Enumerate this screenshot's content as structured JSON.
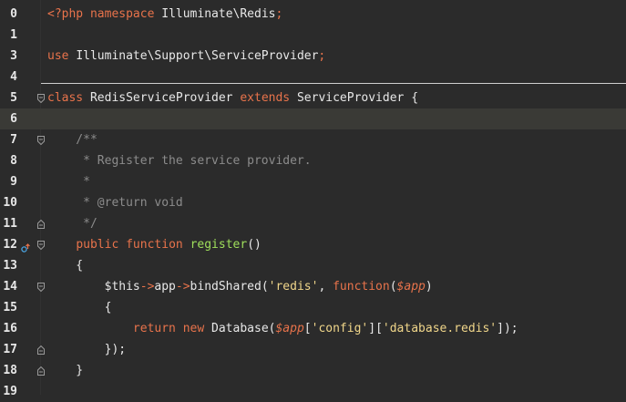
{
  "editor": {
    "language": "php",
    "current_line": 6,
    "colors": {
      "background": "#2b2b2b",
      "current_line": "#3a3a36",
      "keyword": "#e8734b",
      "plain": "#e8e8e8",
      "comment": "#8c8c8c",
      "string": "#f0d68a",
      "function_name": "#9fdf5b"
    },
    "lines": [
      {
        "number": "0",
        "fold": null,
        "tokens": [
          {
            "t": "kw",
            "v": "<?php "
          },
          {
            "t": "kw",
            "v": "namespace "
          },
          {
            "t": "plain",
            "v": "Illuminate\\Redis"
          },
          {
            "t": "kw",
            "v": ";"
          }
        ]
      },
      {
        "number": "1",
        "fold": null,
        "tokens": []
      },
      {
        "number": "3",
        "fold": null,
        "tokens": [
          {
            "t": "kw",
            "v": "use "
          },
          {
            "t": "plain",
            "v": "Illuminate\\Support\\ServiceProvider"
          },
          {
            "t": "kw",
            "v": ";"
          }
        ]
      },
      {
        "number": "4",
        "fold": null,
        "tokens": []
      },
      {
        "number": "5",
        "fold": "open",
        "tokens": [
          {
            "t": "kw",
            "v": "class "
          },
          {
            "t": "plain",
            "v": "RedisServiceProvider "
          },
          {
            "t": "kw",
            "v": "extends "
          },
          {
            "t": "plain",
            "v": "ServiceProvider {"
          }
        ]
      },
      {
        "number": "6",
        "fold": null,
        "tokens": []
      },
      {
        "number": "7",
        "fold": "open",
        "tokens": [
          {
            "t": "cmt",
            "v": "    /**"
          }
        ]
      },
      {
        "number": "8",
        "fold": null,
        "tokens": [
          {
            "t": "cmt",
            "v": "     * Register the service provider."
          }
        ]
      },
      {
        "number": "9",
        "fold": null,
        "tokens": [
          {
            "t": "cmt",
            "v": "     *"
          }
        ]
      },
      {
        "number": "10",
        "fold": null,
        "tokens": [
          {
            "t": "cmt",
            "v": "     * @return void"
          }
        ]
      },
      {
        "number": "11",
        "fold": "close",
        "tokens": [
          {
            "t": "cmt",
            "v": "     */"
          }
        ]
      },
      {
        "number": "12",
        "fold": "open",
        "override": true,
        "tokens": [
          {
            "t": "plain",
            "v": "    "
          },
          {
            "t": "kw",
            "v": "public "
          },
          {
            "t": "kw",
            "v": "function "
          },
          {
            "t": "fn",
            "v": "register"
          },
          {
            "t": "plain",
            "v": "()"
          }
        ]
      },
      {
        "number": "13",
        "fold": null,
        "tokens": [
          {
            "t": "plain",
            "v": "    {"
          }
        ]
      },
      {
        "number": "14",
        "fold": "open",
        "tokens": [
          {
            "t": "plain",
            "v": "        $this"
          },
          {
            "t": "op",
            "v": "->"
          },
          {
            "t": "plain",
            "v": "app"
          },
          {
            "t": "op",
            "v": "->"
          },
          {
            "t": "plain",
            "v": "bindShared("
          },
          {
            "t": "str",
            "v": "'redis'"
          },
          {
            "t": "plain",
            "v": ", "
          },
          {
            "t": "kw",
            "v": "function"
          },
          {
            "t": "plain",
            "v": "("
          },
          {
            "t": "var",
            "v": "$app"
          },
          {
            "t": "plain",
            "v": ")"
          }
        ]
      },
      {
        "number": "15",
        "fold": null,
        "tokens": [
          {
            "t": "plain",
            "v": "        {"
          }
        ]
      },
      {
        "number": "16",
        "fold": null,
        "tokens": [
          {
            "t": "plain",
            "v": "            "
          },
          {
            "t": "kw",
            "v": "return "
          },
          {
            "t": "kw",
            "v": "new "
          },
          {
            "t": "plain",
            "v": "Database("
          },
          {
            "t": "var",
            "v": "$app"
          },
          {
            "t": "plain",
            "v": "["
          },
          {
            "t": "str",
            "v": "'config'"
          },
          {
            "t": "plain",
            "v": "]["
          },
          {
            "t": "str",
            "v": "'database.redis'"
          },
          {
            "t": "plain",
            "v": "]);"
          }
        ]
      },
      {
        "number": "17",
        "fold": "close",
        "tokens": [
          {
            "t": "plain",
            "v": "        });"
          }
        ]
      },
      {
        "number": "18",
        "fold": "close",
        "tokens": [
          {
            "t": "plain",
            "v": "    }"
          }
        ]
      },
      {
        "number": "19",
        "fold": null,
        "tokens": []
      }
    ]
  }
}
